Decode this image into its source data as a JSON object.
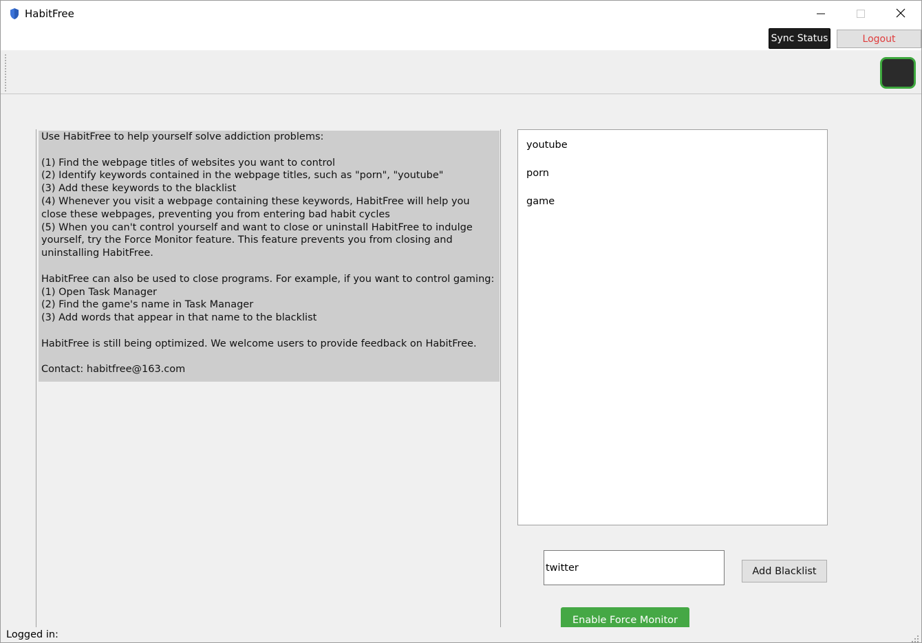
{
  "window": {
    "title": "HabitFree",
    "icon": "shield-icon",
    "controls": [
      "minimize-icon",
      "maximize-icon",
      "close-icon"
    ]
  },
  "header": {
    "sync_label": "Sync Status",
    "logout_label": "Logout",
    "logout_color": "#e03c3c"
  },
  "toolbar": {
    "indicator_color": "#3ea83e"
  },
  "instructions": {
    "lines": [
      "Use HabitFree to help yourself solve addiction problems:",
      "",
      "(1) Find the webpage titles of websites you want to control",
      "(2) Identify keywords contained in the webpage titles, such as \"porn\", \"youtube\"",
      "(3) Add these keywords to the blacklist",
      "(4) Whenever you visit a webpage containing these keywords, HabitFree will help you close these webpages, preventing you from entering bad habit cycles",
      "(5) When you can't control yourself and want to close or uninstall HabitFree to indulge yourself, try the Force Monitor feature. This feature prevents you from closing and uninstalling HabitFree.",
      "",
      "HabitFree can also be used to close programs. For example, if you want to control gaming:",
      "(1) Open Task Manager",
      "(2) Find the game's name in Task Manager",
      "(3) Add words that appear in that name to the blacklist",
      "",
      "HabitFree is still being optimized. We welcome users to provide feedback on HabitFree.",
      "",
      "Contact: habitfree@163.com"
    ]
  },
  "blacklist": {
    "items": [
      "youtube",
      "porn",
      "game"
    ]
  },
  "keyword_input": {
    "value": "twitter"
  },
  "add_label": "Add Blacklist",
  "force_label": "Enable Force Monitor",
  "force_color": "#45a845",
  "status": {
    "text": "Logged in:"
  }
}
